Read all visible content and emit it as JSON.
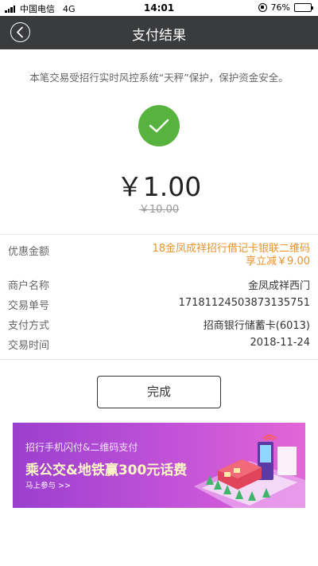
{
  "status_bar": {
    "carrier": "中国电信",
    "network": "4G",
    "time": "14:01",
    "battery": "76%",
    "battery_level": 0.76
  },
  "header": {
    "title": "支付结果",
    "back_icon": "back-icon"
  },
  "notice": "本笔交易受招行实时风控系统“天秤”保护，保护资金安全。",
  "result": {
    "icon": "check-icon",
    "amount": "￥1.00",
    "original_amount": "￥10.00"
  },
  "details": {
    "discount": {
      "label": "优惠金额",
      "value": "18金凤成祥招行借记卡银联二维码享立减￥9.00"
    },
    "merchant": {
      "label": "商户名称",
      "value": "金凤成祥西门"
    },
    "order_no": {
      "label": "交易单号",
      "value": "17181124503873135751"
    },
    "payment": {
      "label": "支付方式",
      "value": "招商银行储蓄卡(6013)"
    },
    "date": {
      "label": "交易时间",
      "value": "2018-11-24"
    }
  },
  "done_button": "完成",
  "banner": {
    "line1": "招行手机闪付&二维码支付",
    "line2": "乘公交&地铁赢300元话费",
    "line3": "马上参与 >>"
  },
  "colors": {
    "header_bg": "#3a3b3d",
    "success": "#57b33d",
    "discount_text": "#e8932a",
    "banner_start": "#9b3fcf",
    "banner_end": "#e266d6"
  }
}
